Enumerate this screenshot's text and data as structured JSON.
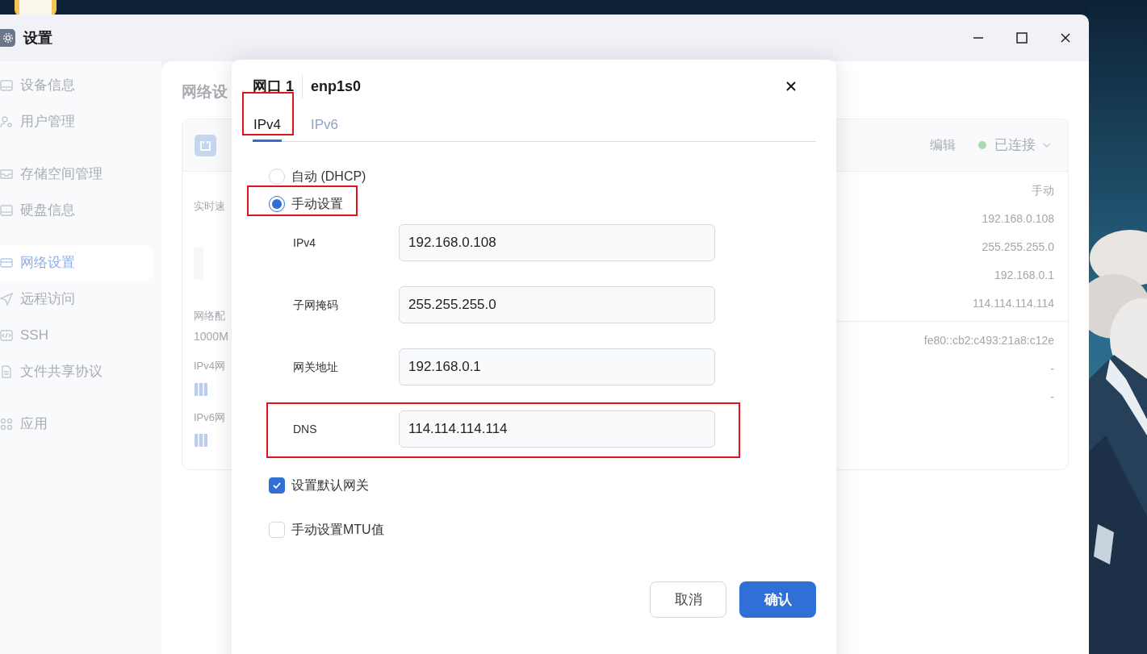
{
  "window": {
    "title": "设置"
  },
  "sidebar": {
    "items": [
      {
        "label": "设备信息",
        "selected": false
      },
      {
        "label": "用户管理",
        "selected": false
      },
      {
        "label": "存储空间管理",
        "selected": false
      },
      {
        "label": "硬盘信息",
        "selected": false
      },
      {
        "label": "网络设置",
        "selected": true
      },
      {
        "label": "远程访问",
        "selected": false
      },
      {
        "label": "SSH",
        "selected": false
      },
      {
        "label": "文件共享协议",
        "selected": false
      },
      {
        "label": "应用",
        "selected": false
      }
    ]
  },
  "page": {
    "title": "网络设",
    "card": {
      "edit": "编辑",
      "status": "已连接",
      "left": [
        {
          "kind": "label",
          "text": "实时速"
        },
        {
          "kind": "bar"
        },
        {
          "kind": "label",
          "text": "网络配"
        },
        {
          "kind": "value",
          "text": "1000M"
        },
        {
          "kind": "label",
          "text": "IPv4网"
        },
        {
          "kind": "icon"
        },
        {
          "kind": "label",
          "text": "IPv6网"
        },
        {
          "kind": "icon"
        }
      ],
      "ipv4_values": [
        "手动",
        "192.168.0.108",
        "255.255.255.0",
        "192.168.0.1",
        "114.114.114.114"
      ],
      "ipv6_values": [
        "fe80::cb2:c493:21a8:c12e",
        "-",
        "-"
      ]
    }
  },
  "dialog": {
    "title": "网口 1",
    "interface": "enp1s0",
    "tabs": [
      {
        "label": "IPv4",
        "selected": true,
        "highlighted": true
      },
      {
        "label": "IPv6",
        "selected": false,
        "highlighted": false
      }
    ],
    "modes": [
      {
        "label": "自动 (DHCP)",
        "selected": false,
        "highlighted": false
      },
      {
        "label": "手动设置",
        "selected": true,
        "highlighted": true
      }
    ],
    "fields": [
      {
        "label": "IPv4",
        "value": "192.168.0.108",
        "highlighted": false
      },
      {
        "label": "子网掩码",
        "value": "255.255.255.0",
        "highlighted": false
      },
      {
        "label": "网关地址",
        "value": "192.168.0.1",
        "highlighted": false
      },
      {
        "label": "DNS",
        "value": "114.114.114.114",
        "highlighted": true
      }
    ],
    "options": [
      {
        "label": "设置默认网关",
        "checked": true
      },
      {
        "label": "手动设置MTU值",
        "checked": false
      }
    ],
    "buttons": [
      {
        "label": "取消",
        "kind": "secondary"
      },
      {
        "label": "确认",
        "kind": "primary"
      }
    ]
  }
}
